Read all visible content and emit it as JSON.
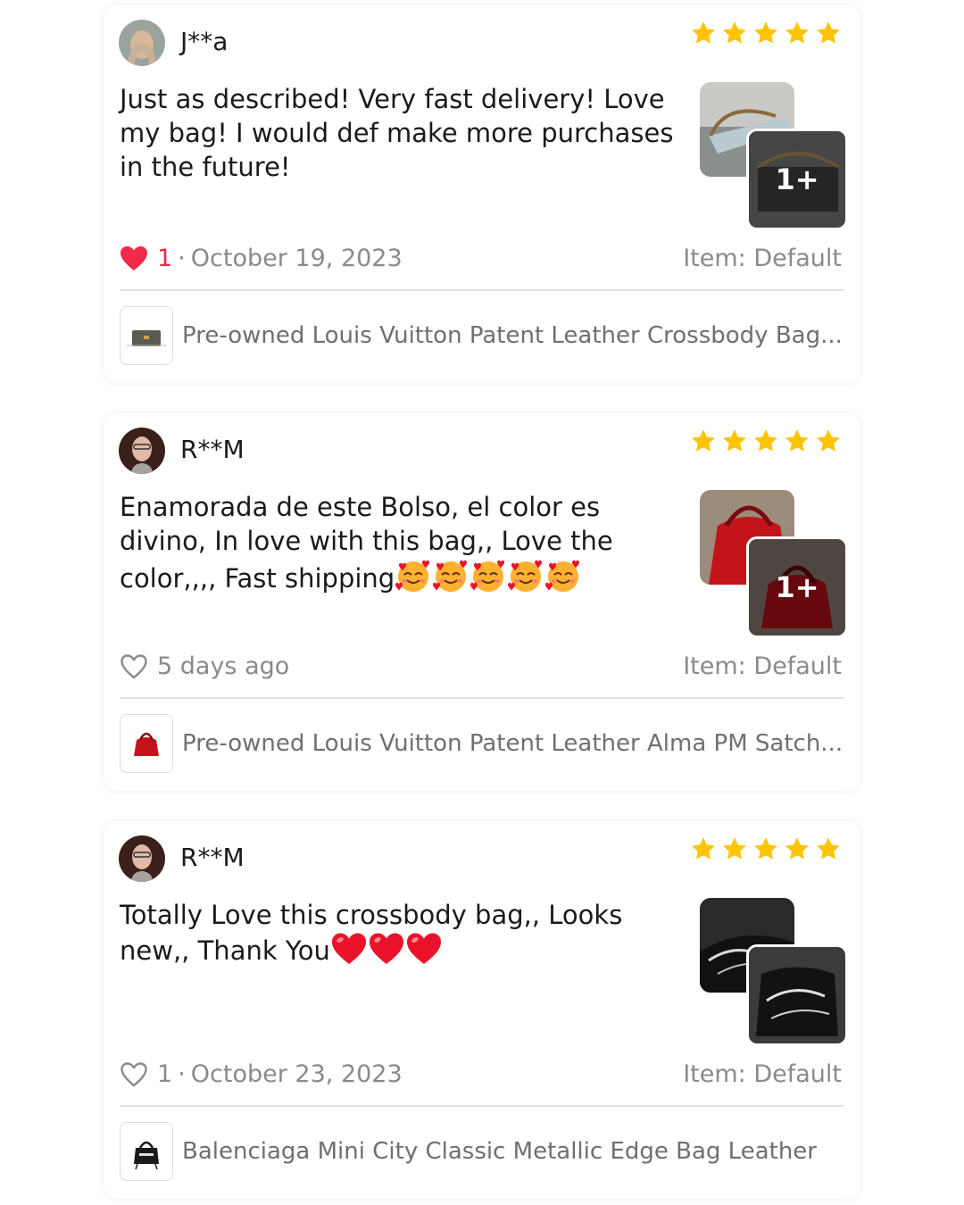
{
  "reviews": [
    {
      "user": "J**a",
      "rating": 5,
      "text": "Just as described! Very fast delivery! Love my bag! I would def make more purchases in the future!",
      "likes": "1",
      "liked": true,
      "date": "October 19, 2023",
      "item": "Item: Default",
      "more_photos": "1+",
      "product": "Pre-owned Louis Vuitton Patent Leather Crossbody Bag..."
    },
    {
      "user": "R**M",
      "rating": 5,
      "text": "Enamorada de este Bolso,  el color es divino,   In love with this bag,,  Love the color,,,,   Fast shipping",
      "likes": "",
      "liked": false,
      "date": "5 days ago",
      "item": "Item: Default",
      "more_photos": "1+",
      "product": "Pre-owned Louis Vuitton Patent Leather Alma PM Satch..."
    },
    {
      "user": "R**M",
      "rating": 5,
      "text": "Totally Love this crossbody bag,, Looks new,,  Thank You",
      "likes": "1",
      "liked": false,
      "date": "October 23, 2023",
      "item": "Item: Default",
      "more_photos": "",
      "product": "Balenciaga Mini City Classic Metallic Edge Bag Leather"
    }
  ],
  "colors": {
    "star": "#FFC400",
    "like_active": "#F0284A",
    "meta_text": "#8A8A8A"
  },
  "icons": {
    "star": "star-icon",
    "like": "heart-icon",
    "emoji_1": "smiling-face-with-hearts",
    "emoji_2": "red-heart"
  }
}
